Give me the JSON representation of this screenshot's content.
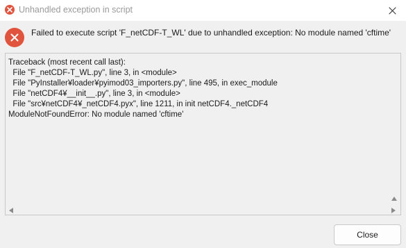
{
  "window": {
    "title": "Unhandled exception in script",
    "title_icon": "error-icon",
    "close_icon": "close-icon"
  },
  "message": {
    "icon": "error-icon",
    "text": "Failed to execute script 'F_netCDF-T_WL' due to unhandled exception: No module named 'cftime'"
  },
  "traceback": {
    "lines": [
      "Traceback (most recent call last):",
      "  File \"F_netCDF-T_WL.py\", line 3, in <module>",
      "  File \"PyInstaller¥loader¥pyimod03_importers.py\", line 495, in exec_module",
      "  File \"netCDF4¥__init__.py\", line 3, in <module>",
      "  File \"src¥netCDF4¥_netCDF4.pyx\", line 1211, in init netCDF4._netCDF4",
      "ModuleNotFoundError: No module named 'cftime'"
    ]
  },
  "buttons": {
    "close_label": "Close"
  },
  "colors": {
    "error_red": "#e0533d",
    "background": "#f0f0f0",
    "titlebar": "#ffffff"
  }
}
